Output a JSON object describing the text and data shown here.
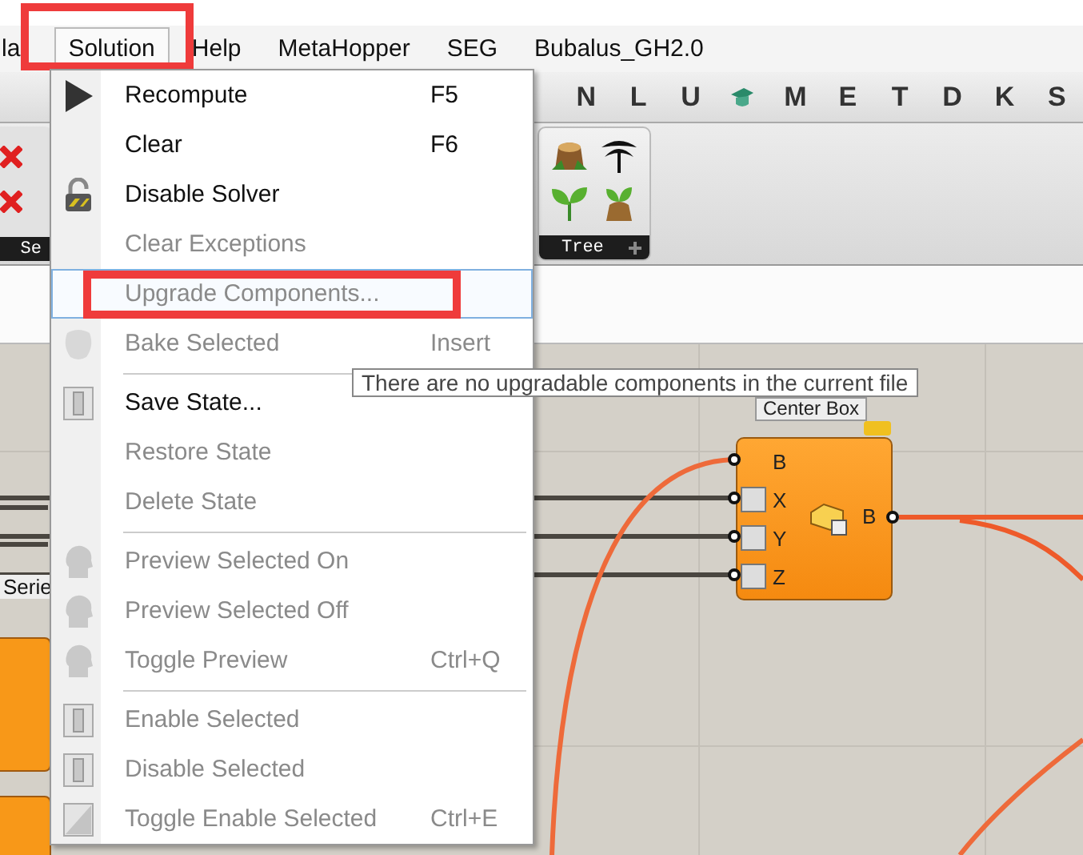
{
  "menubar": [
    {
      "label": "la",
      "selected": false,
      "annotated": false
    },
    {
      "label": "Solution",
      "selected": true,
      "annotated": true
    },
    {
      "label": "Help",
      "selected": false,
      "annotated": false
    },
    {
      "label": "MetaHopper",
      "selected": false,
      "annotated": false
    },
    {
      "label": "SEG",
      "selected": false,
      "annotated": false
    },
    {
      "label": "Bubalus_GH2.0",
      "selected": false,
      "annotated": false
    }
  ],
  "tab_row": [
    {
      "kind": "letter",
      "label": "N"
    },
    {
      "kind": "letter",
      "label": "L"
    },
    {
      "kind": "letter",
      "label": "U"
    },
    {
      "kind": "icon"
    },
    {
      "kind": "letter",
      "label": "M"
    },
    {
      "kind": "letter",
      "label": "E"
    },
    {
      "kind": "letter",
      "label": "T"
    },
    {
      "kind": "letter",
      "label": "D"
    },
    {
      "kind": "letter",
      "label": "K"
    },
    {
      "kind": "letter",
      "label": "S"
    }
  ],
  "ribbon": {
    "panels": [
      {
        "label": "Se"
      },
      {
        "label": "Tree"
      }
    ]
  },
  "menu": {
    "items": [
      {
        "kind": "item",
        "label": "Recompute",
        "shortcut": "F5",
        "disabled": false,
        "highlighted": false,
        "annotated": false
      },
      {
        "kind": "item",
        "label": "Clear",
        "shortcut": "F6",
        "disabled": false,
        "highlighted": false,
        "annotated": false
      },
      {
        "kind": "item",
        "label": "Disable Solver",
        "disabled": false,
        "highlighted": false,
        "annotated": false
      },
      {
        "kind": "item",
        "label": "Clear Exceptions",
        "disabled": true,
        "highlighted": false,
        "annotated": false
      },
      {
        "kind": "item",
        "label": "Upgrade Components...",
        "disabled": true,
        "highlighted": true,
        "annotated": true
      },
      {
        "kind": "item",
        "label": "Bake Selected",
        "shortcut": "Insert",
        "disabled": true,
        "highlighted": false,
        "annotated": false
      },
      {
        "kind": "separator"
      },
      {
        "kind": "item",
        "label": "Save State...",
        "disabled": false,
        "highlighted": false,
        "annotated": false
      },
      {
        "kind": "item",
        "label": "Restore State",
        "disabled": true,
        "highlighted": false,
        "annotated": false
      },
      {
        "kind": "item",
        "label": "Delete State",
        "disabled": true,
        "highlighted": false,
        "annotated": false
      },
      {
        "kind": "separator"
      },
      {
        "kind": "item",
        "label": "Preview Selected On",
        "disabled": true,
        "highlighted": false,
        "annotated": false
      },
      {
        "kind": "item",
        "label": "Preview Selected Off",
        "disabled": true,
        "highlighted": false,
        "annotated": false
      },
      {
        "kind": "item",
        "label": "Toggle Preview",
        "shortcut": "Ctrl+Q",
        "disabled": true,
        "highlighted": false,
        "annotated": false
      },
      {
        "kind": "separator"
      },
      {
        "kind": "item",
        "label": "Enable Selected",
        "disabled": true,
        "highlighted": false,
        "annotated": false
      },
      {
        "kind": "item",
        "label": "Disable Selected",
        "disabled": true,
        "highlighted": false,
        "annotated": false
      },
      {
        "kind": "item",
        "label": "Toggle Enable Selected",
        "shortcut": "Ctrl+E",
        "disabled": true,
        "highlighted": false,
        "annotated": false
      }
    ]
  },
  "tooltip": {
    "text": "There are no upgradable components in the current file"
  },
  "canvas": {
    "labels": [
      {
        "text": "Serie"
      }
    ],
    "component": {
      "title": "Center Box",
      "inputs": [
        {
          "label": "B",
          "marked": false
        },
        {
          "label": "X",
          "marked": true
        },
        {
          "label": "Y",
          "marked": true
        },
        {
          "label": "Z",
          "marked": true
        }
      ],
      "outputs": [
        {
          "label": "B"
        }
      ]
    }
  }
}
